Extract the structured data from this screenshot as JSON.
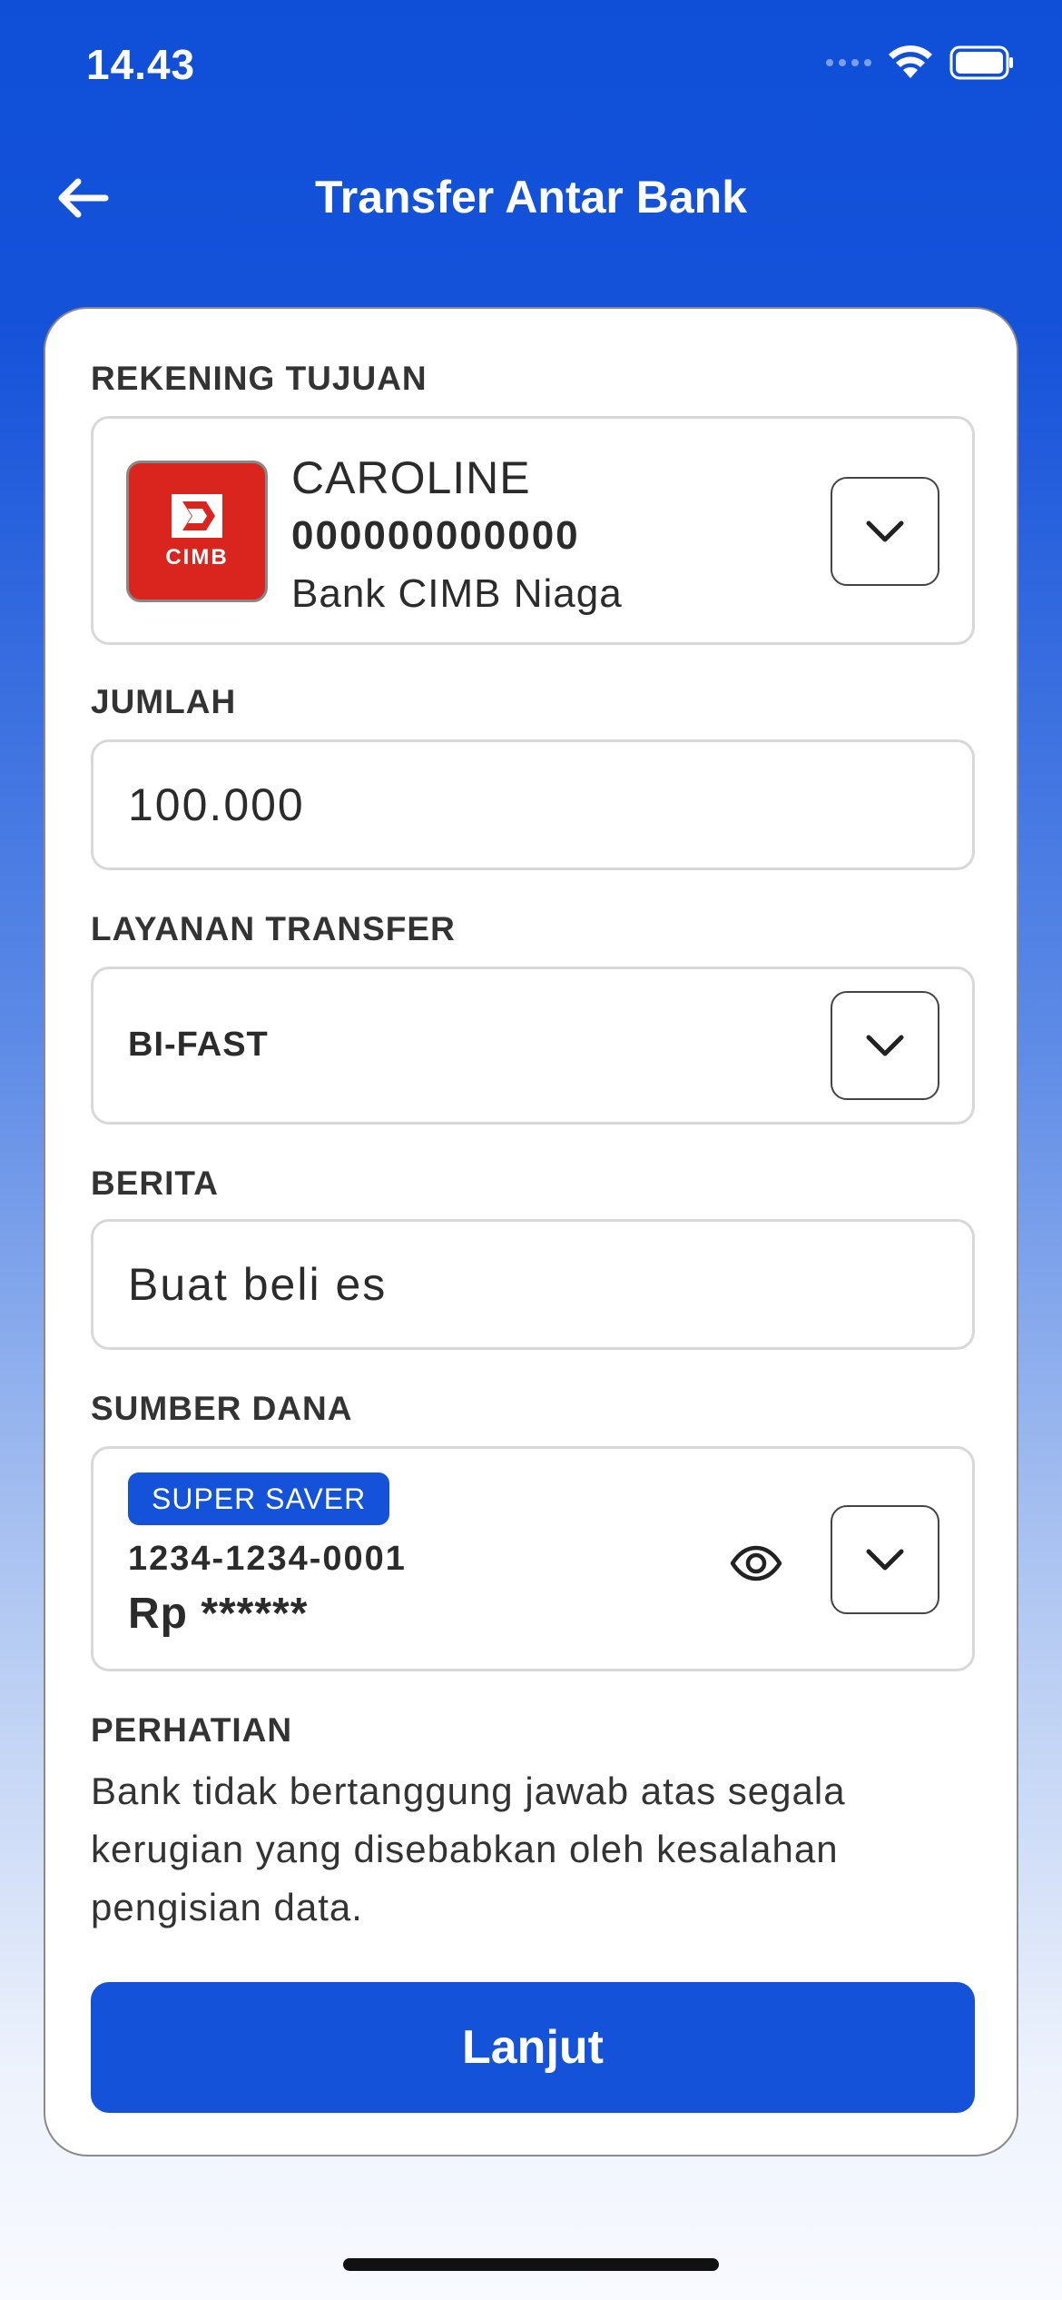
{
  "status_bar": {
    "time": "14.43",
    "battery_level": 1.0
  },
  "header": {
    "title": "Transfer Antar Bank"
  },
  "form": {
    "recipient": {
      "label": "REKENING TUJUAN",
      "bank_logo_text": "CIMB",
      "name": "CAROLINE",
      "account_number": "000000000000",
      "bank_name": "Bank CIMB Niaga"
    },
    "amount": {
      "label": "JUMLAH",
      "value": "100.000"
    },
    "transfer_service": {
      "label": "LAYANAN TRANSFER",
      "value": "BI-FAST"
    },
    "message": {
      "label": "BERITA",
      "value": "Buat beli es"
    },
    "source_of_funds": {
      "label": "SUMBER DANA",
      "badge": "SUPER SAVER",
      "account_number": "1234-1234-0001",
      "balance_masked": "Rp ******"
    },
    "notice": {
      "label": "PERHATIAN",
      "text": "Bank tidak bertanggung jawab atas segala kerugian yang disebabkan oleh kesalahan pengisian data."
    },
    "submit_label": "Lanjut"
  },
  "colors": {
    "brand_blue": "#1552da",
    "cimb_red": "#d9251d"
  },
  "icons": {
    "back": "arrow-left-icon",
    "dropdown": "chevron-down-icon",
    "show_balance": "eye-icon",
    "wifi": "wifi-icon",
    "battery": "battery-icon",
    "signal": "signal-icon"
  }
}
